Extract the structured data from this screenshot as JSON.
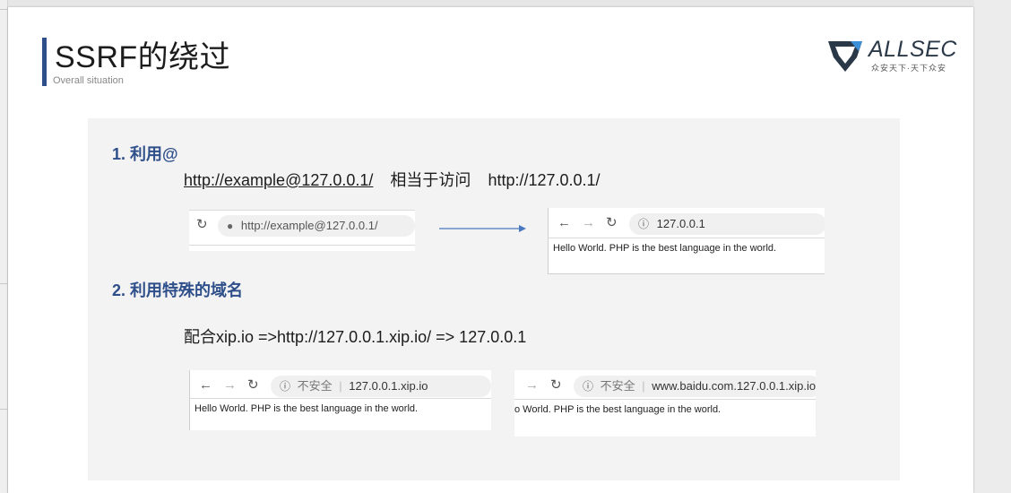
{
  "slide": {
    "title": "SSRF的绕过",
    "subtitle": "Overall situation"
  },
  "logo": {
    "name": "ALLSEC",
    "slogan": "众安天下·天下众安",
    "icon": "shield-logo-icon"
  },
  "section1": {
    "heading": "1. 利用@",
    "example_link": "http://example@127.0.0.1/",
    "middle_text": "相当于访问",
    "target_url": "http://127.0.0.1/",
    "browser_left": {
      "url": "http://example@127.0.0.1/"
    },
    "browser_right": {
      "url": "127.0.0.1",
      "page_text": "Hello World. PHP is the best language in the world."
    }
  },
  "section2": {
    "heading": "2. 利用特殊的域名",
    "line": "配合xip.io =>http://127.0.0.1.xip.io/ => 127.0.0.1",
    "browser_left": {
      "security": "不安全",
      "url": "127.0.0.1.xip.io",
      "page_text": "Hello World. PHP is the best language in the world."
    },
    "browser_right": {
      "security": "不安全",
      "url": "www.baidu.com.127.0.0.1.xip.io",
      "page_text": "o World. PHP is the best language in the world."
    }
  },
  "colors": {
    "accent": "#2e4f8a",
    "background": "#e6e6e6",
    "content_panel": "#f3f3f3"
  }
}
